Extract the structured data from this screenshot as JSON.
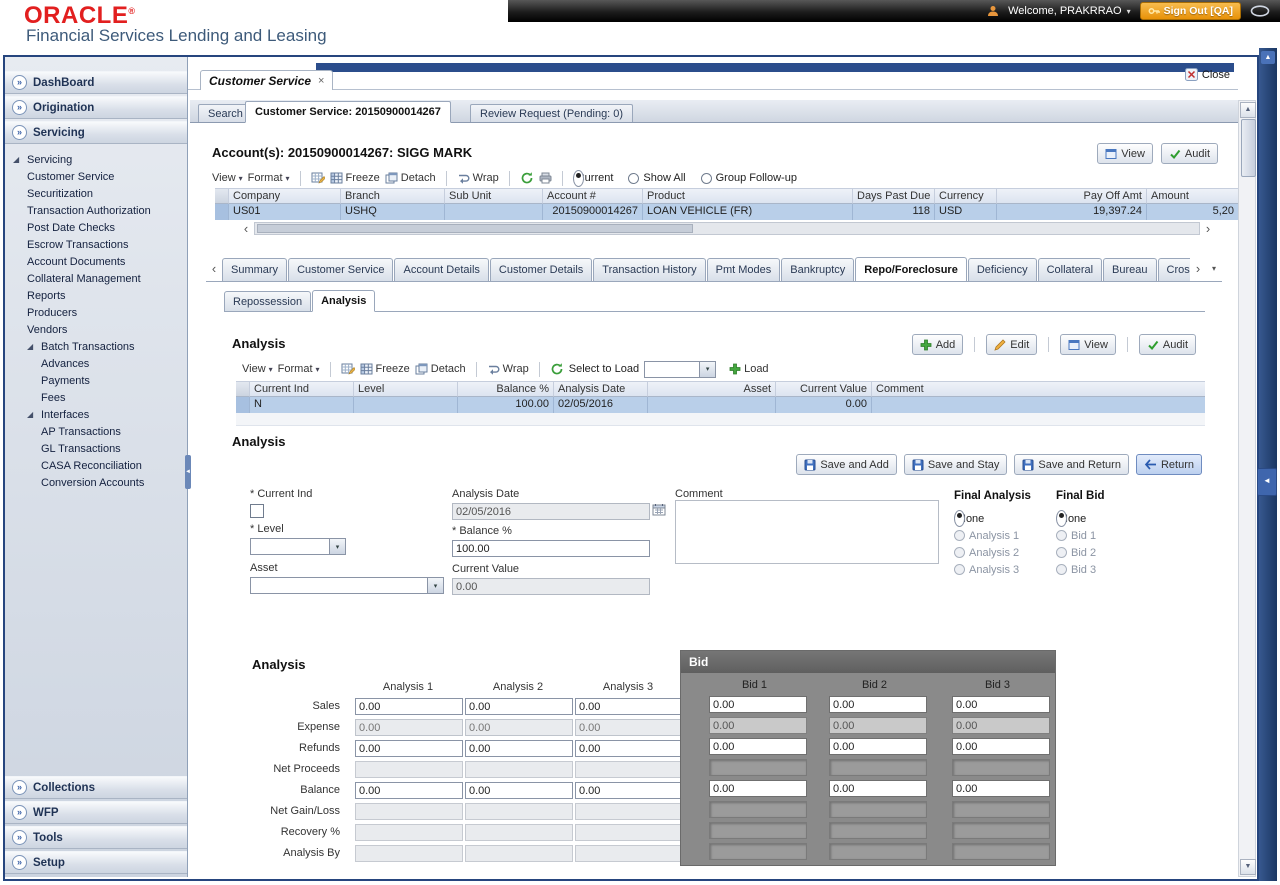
{
  "glyphs": {
    "dropdown": "▾",
    "accordion": "»",
    "tree_open": "◢",
    "close_x": "×",
    "left": "‹",
    "right": "›",
    "up": "▲",
    "down": "▼",
    "splitter": "◄",
    "reg": "®"
  },
  "header": {
    "logo": "ORACLE",
    "subtitle": "Financial Services Lending and Leasing",
    "welcome": "Welcome, PRAKRRAO",
    "signout": "Sign Out [QA]"
  },
  "sidebar": {
    "dashboard": "DashBoard",
    "origination": "Origination",
    "servicing": "Servicing",
    "tree_root": "Servicing",
    "tree_items": [
      "Customer Service",
      "Securitization",
      "Transaction Authorization",
      "Post Date Checks",
      "Escrow Transactions",
      "Account Documents",
      "Collateral Management",
      "Reports",
      "Producers",
      "Vendors"
    ],
    "batch_label": "Batch Transactions",
    "batch_items": [
      "Advances",
      "Payments",
      "Fees"
    ],
    "interfaces_label": "Interfaces",
    "interfaces_items": [
      "AP Transactions",
      "GL Transactions",
      "CASA Reconciliation",
      "Conversion Accounts"
    ],
    "collections": "Collections",
    "wfp": "WFP",
    "tools": "Tools",
    "setup": "Setup"
  },
  "window": {
    "tab": "Customer Service",
    "close": "Close"
  },
  "page_tabs": {
    "search": "Search",
    "active": "Customer Service: 20150900014267",
    "review": "Review Request (Pending: 0)"
  },
  "account": {
    "title": "Account(s): 20150900014267: SIGG MARK",
    "view": "View",
    "audit": "Audit"
  },
  "toolbar1": {
    "view": "View",
    "format": "Format",
    "freeze": "Freeze",
    "detach": "Detach",
    "wrap": "Wrap",
    "current": "Current",
    "show_all": "Show All",
    "group": "Group Follow-up"
  },
  "grid1": {
    "columns": [
      "Company",
      "Branch",
      "Sub Unit",
      "Account #",
      "Product",
      "Days Past Due",
      "Currency",
      "Pay Off Amt",
      "Amount"
    ],
    "row": {
      "company": "US01",
      "branch": "USHQ",
      "sub_unit": "",
      "account": "20150900014267",
      "product": "LOAN VEHICLE (FR)",
      "days_past_due": "118",
      "currency": "USD",
      "pay_off": "19,397.24",
      "amount": "5,20"
    }
  },
  "detail_tabs": [
    "Summary",
    "Customer Service",
    "Account Details",
    "Customer Details",
    "Transaction History",
    "Pmt Modes",
    "Bankruptcy",
    "Repo/Foreclosure",
    "Deficiency",
    "Collateral",
    "Bureau",
    "Cross/Up"
  ],
  "sub_tabs": [
    "Repossession",
    "Analysis"
  ],
  "list": {
    "title": "Analysis",
    "add": "Add",
    "edit": "Edit",
    "view": "View",
    "audit": "Audit",
    "tb": {
      "view": "View",
      "format": "Format",
      "freeze": "Freeze",
      "detach": "Detach",
      "wrap": "Wrap",
      "select_to_load": "Select to Load",
      "load": "Load"
    },
    "columns": [
      "Current Ind",
      "Level",
      "Balance %",
      "Analysis Date",
      "Asset",
      "Current Value",
      "Comment"
    ],
    "row": {
      "current_ind": "N",
      "level": "",
      "balance": "100.00",
      "date": "02/05/2016",
      "asset": "",
      "current_value": "0.00",
      "comment": ""
    }
  },
  "form": {
    "title": "Analysis",
    "save_add": "Save and Add",
    "save_stay": "Save and Stay",
    "save_return": "Save and Return",
    "return_btn": "Return",
    "current_ind_label": "* Current Ind",
    "level_label": "* Level",
    "asset_label": "Asset",
    "date_label": "Analysis Date",
    "date_value": "02/05/2016",
    "balance_label": "* Balance %",
    "balance_value": "100.00",
    "current_value_label": "Current Value",
    "current_value": "0.00",
    "comment_label": "Comment",
    "comment_value": "",
    "final_analysis_title": "Final Analysis",
    "fa_options": [
      "None",
      "Analysis 1",
      "Analysis 2",
      "Analysis 3"
    ],
    "final_bid_title": "Final Bid",
    "fb_options": [
      "None",
      "Bid 1",
      "Bid 2",
      "Bid 3"
    ]
  },
  "matrix": {
    "title": "Analysis",
    "headers": [
      "Analysis 1",
      "Analysis 2",
      "Analysis 3"
    ],
    "labels": [
      "Sales",
      "Expense",
      "Refunds",
      "Net Proceeds",
      "Balance",
      "Net Gain/Loss",
      "Recovery %",
      "Analysis By"
    ],
    "rows": [
      [
        "0.00",
        "0.00",
        "0.00"
      ],
      [
        "0.00",
        "0.00",
        "0.00"
      ],
      [
        "0.00",
        "0.00",
        "0.00"
      ],
      [
        "",
        "",
        ""
      ],
      [
        "0.00",
        "0.00",
        "0.00"
      ],
      [
        "",
        "",
        ""
      ],
      [
        "",
        "",
        ""
      ],
      [
        "",
        "",
        ""
      ]
    ]
  },
  "bid": {
    "title": "Bid",
    "headers": [
      "Bid 1",
      "Bid 2",
      "Bid 3"
    ],
    "rows": [
      [
        "0.00",
        "0.00",
        "0.00"
      ],
      [
        "0.00",
        "0.00",
        "0.00"
      ],
      [
        "0.00",
        "0.00",
        "0.00"
      ],
      [
        "",
        "",
        ""
      ],
      [
        "0.00",
        "0.00",
        "0.00"
      ],
      [
        "",
        "",
        ""
      ],
      [
        "",
        "",
        ""
      ],
      [
        "",
        "",
        ""
      ]
    ]
  }
}
